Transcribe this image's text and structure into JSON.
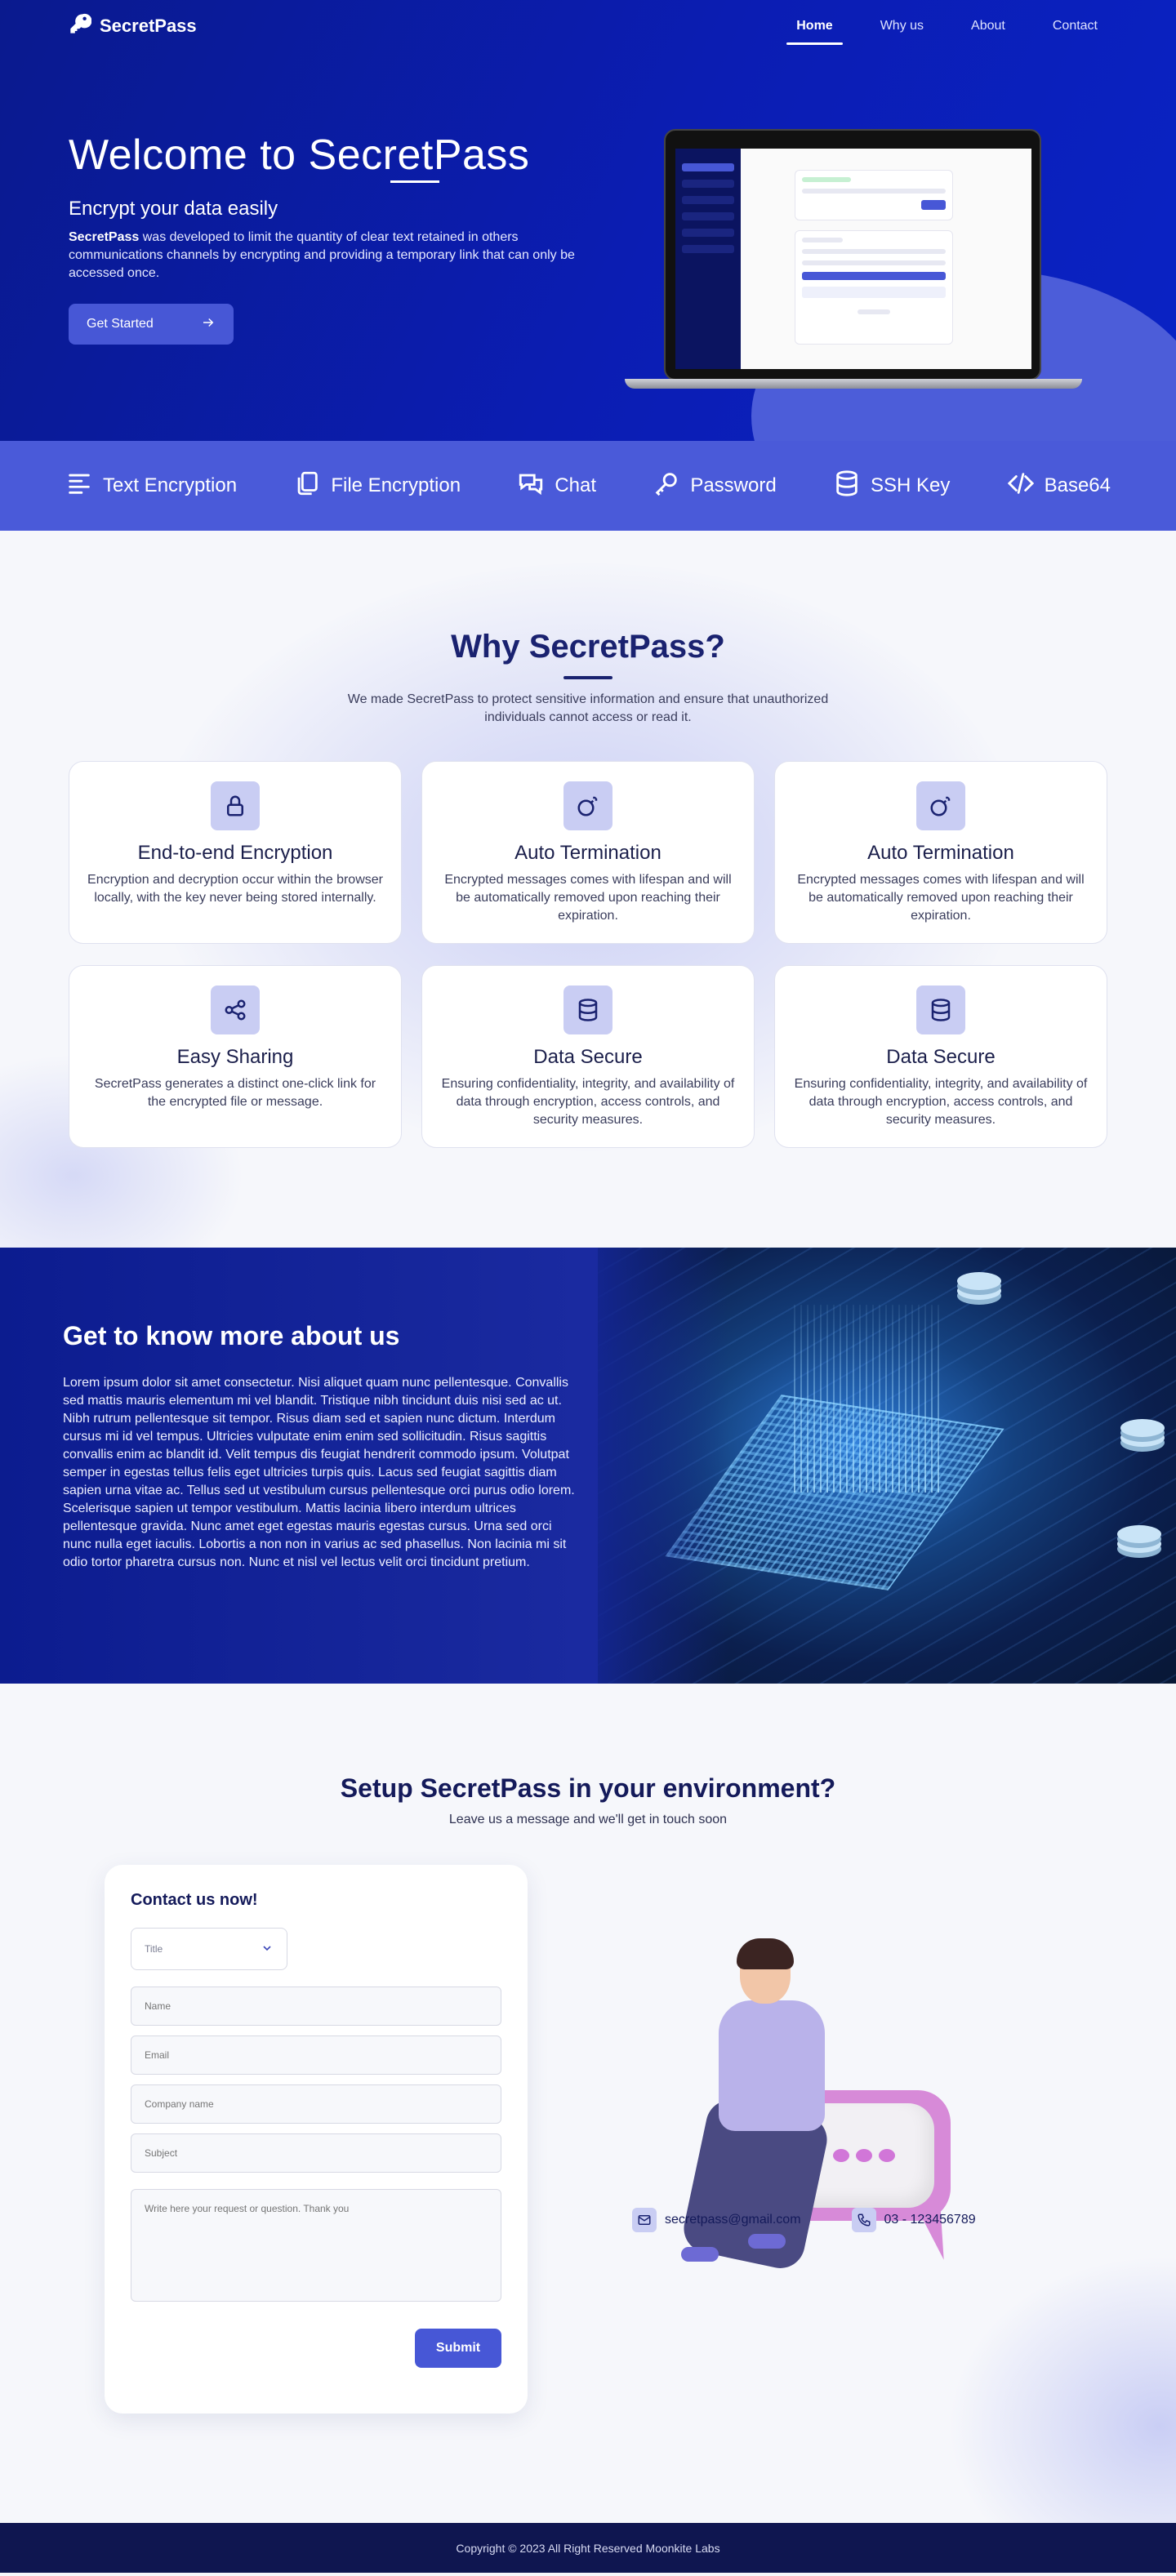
{
  "nav": {
    "brand": "SecretPass",
    "links": [
      {
        "label": "Home",
        "active": true
      },
      {
        "label": "Why us",
        "active": false
      },
      {
        "label": "About",
        "active": false
      },
      {
        "label": "Contact",
        "active": false
      }
    ]
  },
  "hero": {
    "title_prefix": "Welcome to ",
    "title_brand": "SecretPass",
    "subtitle": "Encrypt your data easily",
    "desc_bold": "SecretPass",
    "desc_rest": " was developed to limit the quantity of clear text retained in others communications channels by encrypting and providing a temporary link that can only be accessed once.",
    "cta_label": "Get Started",
    "cta_icon": "arrow-right-icon"
  },
  "features_strip": [
    {
      "label": "Text Encryption",
      "icon": "text-align-icon"
    },
    {
      "label": "File Encryption",
      "icon": "files-icon"
    },
    {
      "label": "Chat",
      "icon": "chat-icon"
    },
    {
      "label": "Password",
      "icon": "key-icon"
    },
    {
      "label": "SSH Key",
      "icon": "database-icon"
    },
    {
      "label": "Base64",
      "icon": "code-icon"
    }
  ],
  "why": {
    "title": "Why SecretPass?",
    "desc": "We made SecretPass to protect sensitive information and ensure that unauthorized individuals cannot access or read it.",
    "cards": [
      {
        "icon": "lock-icon",
        "title": "End-to-end Encryption",
        "desc": "Encryption and decryption occur within the browser locally, with the key never being stored internally."
      },
      {
        "icon": "bomb-icon",
        "title": "Auto Termination",
        "desc": "Encrypted messages comes with lifespan and will be automatically removed upon reaching their expiration."
      },
      {
        "icon": "bomb-icon",
        "title": "Auto Termination",
        "desc": "Encrypted messages comes with lifespan and will be automatically removed upon reaching their expiration."
      },
      {
        "icon": "share-icon",
        "title": "Easy Sharing",
        "desc": "SecretPass generates a distinct one-click link for the encrypted file or message."
      },
      {
        "icon": "database-icon",
        "title": "Data Secure",
        "desc": "Ensuring confidentiality, integrity, and availability of data through encryption, access controls, and security measures."
      },
      {
        "icon": "database-icon",
        "title": "Data Secure",
        "desc": "Ensuring confidentiality, integrity, and availability of data through encryption, access controls, and security measures."
      }
    ]
  },
  "about": {
    "title": "Get to know more about us",
    "body": "Lorem ipsum dolor sit amet consectetur. Nisi aliquet quam nunc pellentesque. Convallis sed mattis mauris elementum mi vel blandit. Tristique nibh tincidunt duis nisi sed ac ut. Nibh rutrum pellentesque sit tempor. Risus diam sed et sapien nunc dictum. Interdum cursus mi id vel tempus. Ultricies vulputate enim enim sed sollicitudin. Risus sagittis convallis enim ac blandit id. Velit tempus dis feugiat hendrerit commodo ipsum. Volutpat semper in egestas tellus felis eget ultricies turpis quis. Lacus sed feugiat sagittis diam sapien urna vitae ac. Tellus sed ut vestibulum cursus pellentesque orci purus odio lorem. Scelerisque sapien ut tempor vestibulum. Mattis lacinia libero interdum ultrices pellentesque gravida. Nunc amet eget egestas mauris egestas cursus. Urna sed orci nunc nulla eget iaculis. Lobortis a non non in varius ac sed phasellus. Non lacinia mi sit odio tortor pharetra cursus non. Nunc et nisl vel lectus velit orci tincidunt pretium."
  },
  "contact": {
    "title": "Setup SecretPass in your environment?",
    "subtitle": "Leave us a message and we'll get in touch soon",
    "form_title": "Contact us now!",
    "select_placeholder": "Title",
    "fields": {
      "name": "Name",
      "email": "Email",
      "company": "Company name",
      "subject": "Subject",
      "message": "Write here your request or question. Thank you"
    },
    "submit_label": "Submit",
    "email": "secretpass@gmail.com",
    "phone": "03 - 123456789"
  },
  "footer": {
    "copyright": "Copyright © 2023 All Right Reserved Moonkite Labs"
  },
  "colors": {
    "hero_bg": "#0b1db3",
    "accent": "#4757d6",
    "strip_bg": "#4a5ad9",
    "footer_bg": "#0f1650",
    "heading": "#1a2270"
  }
}
